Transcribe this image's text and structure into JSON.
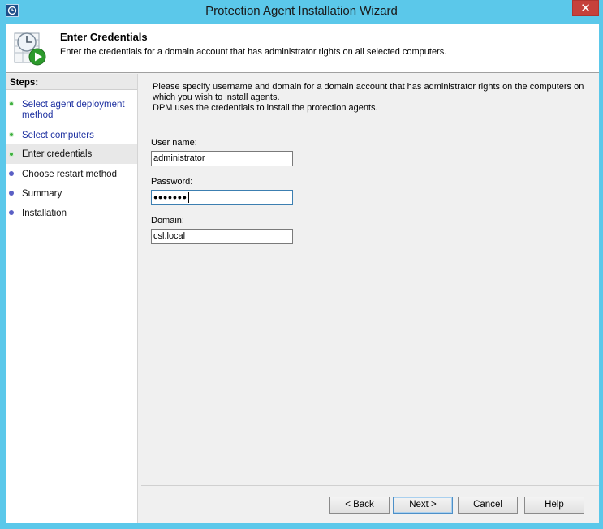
{
  "window": {
    "title": "Protection Agent Installation Wizard",
    "close_label": "✕"
  },
  "header": {
    "title": "Enter Credentials",
    "description": "Enter the credentials for a domain account that has administrator rights on all selected computers."
  },
  "steps": {
    "title": "Steps:",
    "items": [
      {
        "label": "Select agent deployment method",
        "state": "done"
      },
      {
        "label": "Select computers",
        "state": "done"
      },
      {
        "label": "Enter credentials",
        "state": "current"
      },
      {
        "label": "Choose restart method",
        "state": "todo"
      },
      {
        "label": "Summary",
        "state": "todo"
      },
      {
        "label": "Installation",
        "state": "todo"
      }
    ]
  },
  "main": {
    "intro_line1": "Please specify username and domain for a domain account that has administrator rights on the computers on which you wish to install agents.",
    "intro_line2": "DPM uses the credentials to install the protection agents.",
    "username_label": "User name:",
    "username_value": "administrator",
    "password_label": "Password:",
    "password_value": "●●●●●●●",
    "domain_label": "Domain:",
    "domain_value": "csl.local"
  },
  "buttons": {
    "back": "< Back",
    "next": "Next >",
    "cancel": "Cancel",
    "help": "Help"
  },
  "colors": {
    "titlebar": "#5bc8ea",
    "close": "#c6413b",
    "step_done": "#3fb03f",
    "step_todo": "#5a5fc5"
  }
}
